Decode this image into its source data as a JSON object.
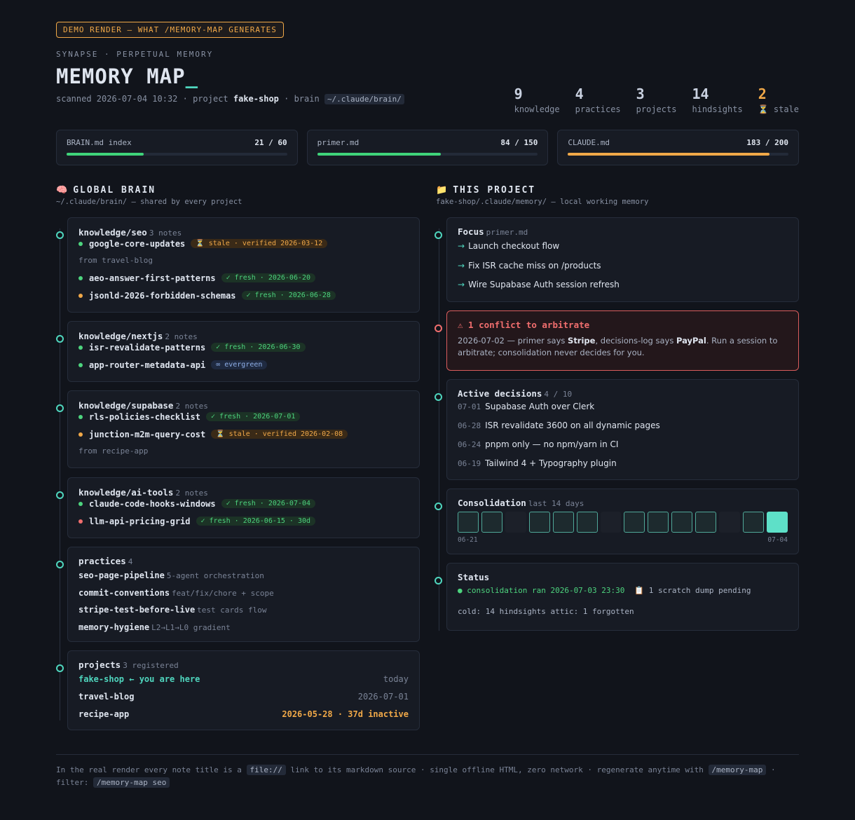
{
  "badge": "DEMO RENDER — WHAT /MEMORY-MAP GENERATES",
  "eyebrow": "SYNAPSE · PERPETUAL MEMORY",
  "title": "MEMORY MAP",
  "title_cursor": "_",
  "subline": {
    "scanned_prefix": "scanned 2026-07-04 10:32 · project ",
    "project": "fake-shop",
    "brain_prefix": " · brain ",
    "brain_path": "~/.claude/brain/"
  },
  "stats": [
    {
      "num": "9",
      "label": "knowledge"
    },
    {
      "num": "4",
      "label": "practices"
    },
    {
      "num": "3",
      "label": "projects"
    },
    {
      "num": "14",
      "label": "hindsights"
    },
    {
      "num": "2",
      "label": "⏳ stale"
    }
  ],
  "budgets": [
    {
      "name": "BRAIN.md index",
      "count": "21 / 60",
      "fraction": 0.35,
      "color": "#3fd47a"
    },
    {
      "name": "primer.md",
      "count": "84 / 150",
      "fraction": 0.56,
      "color": "#3fd47a"
    },
    {
      "name": "CLAUDE.md",
      "count": "183 / 200",
      "fraction": 0.915,
      "color": "#f0a848"
    }
  ],
  "global": {
    "icon": "🧠",
    "heading": "GLOBAL BRAIN",
    "sub": "~/.claude/brain/ — shared by every project"
  },
  "project": {
    "icon": "📁",
    "heading": "THIS PROJECT",
    "sub": "fake-shop/.claude/memory/ — local working memory"
  },
  "knowledge": [
    {
      "title": "knowledge/seo",
      "meta": "3 notes",
      "rows": [
        {
          "kind": "note",
          "name": "google-core-updates",
          "dot": "#4dd47e",
          "tag": "⏳ stale · verified 2026-03-12",
          "tagtype": "stale"
        },
        {
          "kind": "from",
          "text": "from travel-blog"
        },
        {
          "kind": "note",
          "name": "aeo-answer-first-patterns",
          "dot": "#4dd47e",
          "tag": "✓ fresh · 2026-06-20",
          "tagtype": "fresh"
        },
        {
          "kind": "note",
          "name": "jsonld-2026-forbidden-schemas",
          "dot": "#f0a848",
          "tag": "✓ fresh · 2026-06-28",
          "tagtype": "fresh"
        }
      ]
    },
    {
      "title": "knowledge/nextjs",
      "meta": "2 notes",
      "rows": [
        {
          "kind": "note",
          "name": "isr-revalidate-patterns",
          "dot": "#4dd47e",
          "tag": "✓ fresh · 2026-06-30",
          "tagtype": "fresh"
        },
        {
          "kind": "note",
          "name": "app-router-metadata-api",
          "dot": "#4dd47e",
          "tag": "∞ evergreen",
          "tagtype": "ever"
        }
      ]
    },
    {
      "title": "knowledge/supabase",
      "meta": "2 notes",
      "rows": [
        {
          "kind": "note",
          "name": "rls-policies-checklist",
          "dot": "#4dd47e",
          "tag": "✓ fresh · 2026-07-01",
          "tagtype": "fresh"
        },
        {
          "kind": "note",
          "name": "junction-m2m-query-cost",
          "dot": "#f0a848",
          "tag": "⏳ stale · verified 2026-02-08",
          "tagtype": "stale"
        },
        {
          "kind": "from",
          "text": "from recipe-app"
        }
      ]
    },
    {
      "title": "knowledge/ai-tools",
      "meta": "2 notes",
      "rows": [
        {
          "kind": "note",
          "name": "claude-code-hooks-windows",
          "dot": "#4dd47e",
          "tag": "✓ fresh · 2026-07-04",
          "tagtype": "fresh"
        },
        {
          "kind": "note",
          "name": "llm-api-pricing-grid",
          "dot": "#f06e6e",
          "tag": "✓ fresh · 2026-06-15 · 30d",
          "tagtype": "fresh"
        }
      ]
    }
  ],
  "practices": {
    "title": "practices",
    "meta": "4",
    "items": [
      {
        "name": "seo-page-pipeline",
        "desc": "5-agent orchestration"
      },
      {
        "name": "commit-conventions",
        "desc": "feat/fix/chore + scope"
      },
      {
        "name": "stripe-test-before-live",
        "desc": "test cards flow"
      },
      {
        "name": "memory-hygiene",
        "desc": "L2→L1→L0 gradient"
      }
    ]
  },
  "projects": {
    "title": "projects",
    "meta": "3 registered",
    "items": [
      {
        "name": "fake-shop ← you are here",
        "right": "today",
        "here": true,
        "warn": false
      },
      {
        "name": "travel-blog",
        "right": "2026-07-01",
        "here": false,
        "warn": false
      },
      {
        "name": "recipe-app",
        "right": "2026-05-28 · 37d inactive",
        "here": false,
        "warn": true
      }
    ]
  },
  "focus": {
    "title": "Focus",
    "meta": "primer.md",
    "items": [
      "Launch checkout flow",
      "Fix ISR cache miss on /products",
      "Wire Supabase Auth session refresh"
    ]
  },
  "conflict": {
    "title": "⚠ 1 conflict to arbitrate",
    "body_1": "2026-07-02 — primer says ",
    "b1": "Stripe",
    "body_2": ", decisions-log says ",
    "b2": "PayPal",
    "body_3": ". Run a session to arbitrate; consolidation never decides for you."
  },
  "decisions": {
    "title": "Active decisions",
    "meta": "4 / 10",
    "items": [
      {
        "date": "07-01",
        "text": "Supabase Auth over Clerk"
      },
      {
        "date": "06-28",
        "text": "ISR revalidate 3600 on all dynamic pages"
      },
      {
        "date": "06-24",
        "text": "pnpm only — no npm/yarn in CI"
      },
      {
        "date": "06-19",
        "text": "Tailwind 4 + Typography plugin"
      }
    ]
  },
  "consolidation": {
    "title": "Consolidation",
    "meta": "last 14 days",
    "days": [
      1,
      1,
      0,
      1,
      1,
      1,
      0,
      1,
      1,
      1,
      1,
      0,
      1,
      2
    ],
    "start": "06-21",
    "end": "07-04"
  },
  "status": {
    "title": "Status",
    "line1": "● consolidation ran 2026-07-03 23:30",
    "line1b": "📋 1 scratch dump pending",
    "line2": "cold: 14 hindsights  attic: 1 forgotten"
  },
  "footer": {
    "t1": "In the real render every note title is a ",
    "c1": "file://",
    "t2": " link to its markdown source · single offline HTML, zero network · regenerate anytime with ",
    "c2": "/memory-map",
    "t3": " · filter: ",
    "c3": "/memory-map seo"
  }
}
